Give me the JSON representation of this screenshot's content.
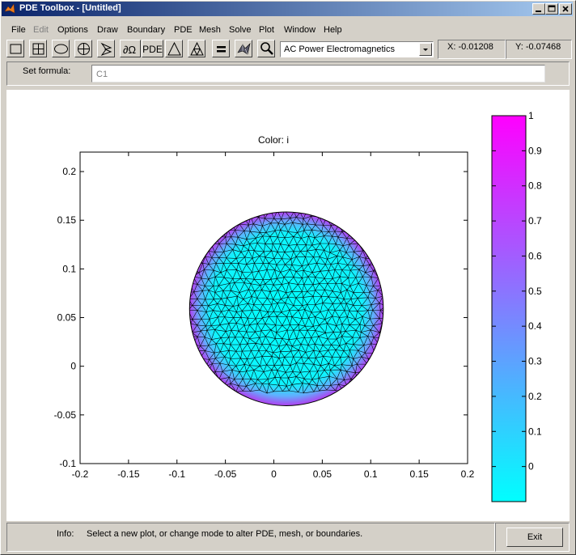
{
  "window": {
    "title": "PDE Toolbox - [Untitled]",
    "controls": [
      "minimize-icon",
      "maximize-icon",
      "close-icon"
    ]
  },
  "menu": {
    "items": [
      {
        "label": "File",
        "enabled": true
      },
      {
        "label": "Edit",
        "enabled": false
      },
      {
        "label": "Options",
        "enabled": true
      },
      {
        "label": "Draw",
        "enabled": true
      },
      {
        "label": "Boundary",
        "enabled": true
      },
      {
        "label": "PDE",
        "enabled": true
      },
      {
        "label": "Mesh",
        "enabled": true
      },
      {
        "label": "Solve",
        "enabled": true
      },
      {
        "label": "Plot",
        "enabled": true
      },
      {
        "label": "Window",
        "enabled": true
      },
      {
        "label": "Help",
        "enabled": true
      }
    ]
  },
  "toolbar": {
    "pde_label": "PDE",
    "tools": [
      "rectangle-icon",
      "rectangle-centered-icon",
      "ellipse-icon",
      "ellipse-centered-icon",
      "polygon-icon",
      "boundary-mode-icon",
      "pde-spec-button",
      "init-mesh-icon",
      "refine-mesh-icon",
      "solve-icon",
      "plot-icon",
      "zoom-icon"
    ]
  },
  "application_mode": {
    "selected": "AC Power Electromagnetics"
  },
  "coords": {
    "x_text": "X:  -0.01208",
    "y_text": "Y:  -0.07468"
  },
  "formula": {
    "label": "Set formula:",
    "value": "C1"
  },
  "plot": {
    "title": "Color: i"
  },
  "chart_data": {
    "type": "mesh-colormap",
    "title": "Color: i",
    "xlim": [
      -0.2,
      0.2
    ],
    "ylim": [
      -0.1,
      0.22
    ],
    "xticks": [
      "-0.2",
      "-0.15",
      "-0.1",
      "-0.05",
      "0",
      "0.05",
      "0.1",
      "0.15",
      "0.2"
    ],
    "yticks": [
      "-0.1",
      "-0.05",
      "0",
      "0.05",
      "0.1",
      "0.15",
      "0.2"
    ],
    "circle": {
      "center": [
        0.013,
        0.059
      ],
      "radius": 0.1
    },
    "colorbar": {
      "ticks": [
        "0",
        "0.1",
        "0.2",
        "0.3",
        "0.4",
        "0.5",
        "0.6",
        "0.7",
        "0.8",
        "0.9",
        "1"
      ],
      "range": [
        -0.1,
        1.0
      ],
      "colormap_low": "#00ffff",
      "colormap_high": "#ff00ff"
    }
  },
  "status": {
    "info_label": "Info:",
    "info_text": "Select a new plot, or change mode to alter PDE, mesh, or boundaries.",
    "exit_label": "Exit"
  }
}
